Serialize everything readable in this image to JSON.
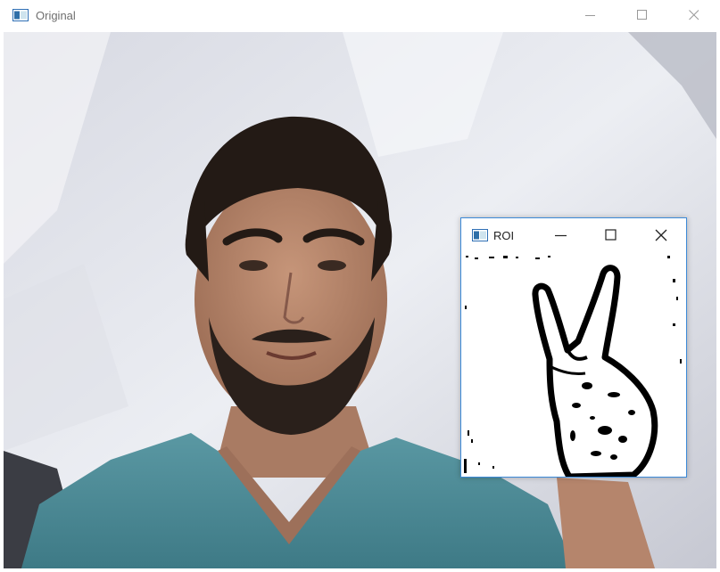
{
  "window": {
    "title": "Original",
    "controls": [
      "minimize-icon",
      "maximize-icon",
      "close-icon"
    ]
  },
  "roi_window": {
    "title": "ROI",
    "controls": [
      "minimize-icon",
      "maximize-icon",
      "close-icon"
    ]
  },
  "colors": {
    "background_sheet": "#e6e8ef",
    "shirt": "#4e8d98",
    "skin": "#b8876e",
    "hair": "#231a15",
    "roi_border": "#3c8ad8"
  }
}
